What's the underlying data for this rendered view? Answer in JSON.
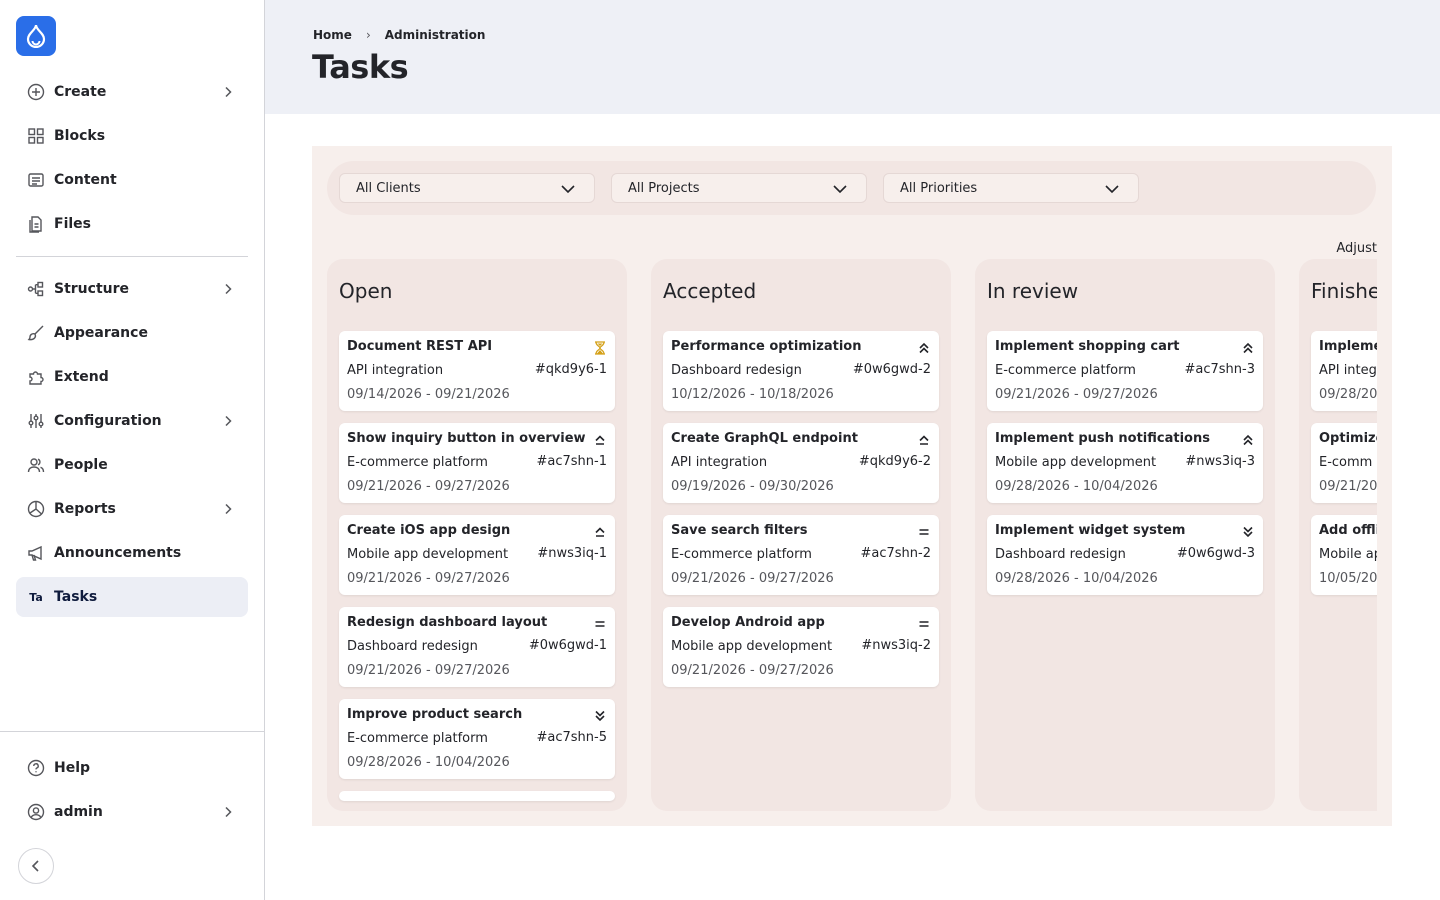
{
  "sidebar": {
    "items": [
      {
        "label": "Create",
        "icon": "plus-circle-icon",
        "has_submenu": true
      },
      {
        "label": "Blocks",
        "icon": "blocks-grid-icon",
        "has_submenu": false
      },
      {
        "label": "Content",
        "icon": "content-doc-icon",
        "has_submenu": false
      },
      {
        "label": "Files",
        "icon": "files-icon",
        "has_submenu": false
      },
      {
        "label": "Structure",
        "icon": "structure-icon",
        "has_submenu": true
      },
      {
        "label": "Appearance",
        "icon": "paintbrush-icon",
        "has_submenu": false
      },
      {
        "label": "Extend",
        "icon": "puzzle-icon",
        "has_submenu": false
      },
      {
        "label": "Configuration",
        "icon": "sliders-icon",
        "has_submenu": true
      },
      {
        "label": "People",
        "icon": "people-icon",
        "has_submenu": false
      },
      {
        "label": "Reports",
        "icon": "pie-chart-icon",
        "has_submenu": true
      },
      {
        "label": "Announcements",
        "icon": "megaphone-icon",
        "has_submenu": false
      },
      {
        "label": "Tasks",
        "icon": "tasks-badge",
        "badge": "Ta",
        "has_submenu": false,
        "active": true
      }
    ],
    "footer": [
      {
        "label": "Help",
        "icon": "help-icon"
      },
      {
        "label": "admin",
        "icon": "user-icon",
        "has_submenu": true
      }
    ]
  },
  "header": {
    "breadcrumb": [
      "Home",
      "Administration"
    ],
    "title": "Tasks"
  },
  "filters": {
    "clients": "All Clients",
    "projects": "All Projects",
    "priorities": "All Priorities"
  },
  "adjust_label": "Adjust",
  "colors": {
    "accent": "#2a6ee8",
    "board_bg": "#f7efec",
    "column_bg": "#f2e6e3",
    "header_bg": "#eef0f6",
    "pending_icon": "#d4a017"
  },
  "columns": [
    {
      "title": "Open",
      "cards": [
        {
          "title": "Document REST API",
          "project": "API integration",
          "id": "#qkd9y6-1",
          "dates": "09/14/2026 - 09/21/2026",
          "priority": "pending"
        },
        {
          "title": "Show inquiry button in overview",
          "project": "E-commerce platform",
          "id": "#ac7shn-1",
          "dates": "09/21/2026 - 09/27/2026",
          "priority": "high"
        },
        {
          "title": "Create iOS app design",
          "project": "Mobile app development",
          "id": "#nws3iq-1",
          "dates": "09/21/2026 - 09/27/2026",
          "priority": "high"
        },
        {
          "title": "Redesign dashboard layout",
          "project": "Dashboard redesign",
          "id": "#0w6gwd-1",
          "dates": "09/21/2026 - 09/27/2026",
          "priority": "medium"
        },
        {
          "title": "Improve product search",
          "project": "E-commerce platform",
          "id": "#ac7shn-5",
          "dates": "09/28/2026 - 10/04/2026",
          "priority": "low"
        }
      ]
    },
    {
      "title": "Accepted",
      "cards": [
        {
          "title": "Performance optimization",
          "project": "Dashboard redesign",
          "id": "#0w6gwd-2",
          "dates": "10/12/2026 - 10/18/2026",
          "priority": "highest"
        },
        {
          "title": "Create GraphQL endpoint",
          "project": "API integration",
          "id": "#qkd9y6-2",
          "dates": "09/19/2026 - 09/30/2026",
          "priority": "high"
        },
        {
          "title": "Save search filters",
          "project": "E-commerce platform",
          "id": "#ac7shn-2",
          "dates": "09/21/2026 - 09/27/2026",
          "priority": "medium"
        },
        {
          "title": "Develop Android app",
          "project": "Mobile app development",
          "id": "#nws3iq-2",
          "dates": "09/21/2026 - 09/27/2026",
          "priority": "medium"
        }
      ]
    },
    {
      "title": "In review",
      "cards": [
        {
          "title": "Implement shopping cart",
          "project": "E-commerce platform",
          "id": "#ac7shn-3",
          "dates": "09/21/2026 - 09/27/2026",
          "priority": "highest"
        },
        {
          "title": "Implement push notifications",
          "project": "Mobile app development",
          "id": "#nws3iq-3",
          "dates": "09/28/2026 - 10/04/2026",
          "priority": "highest"
        },
        {
          "title": "Implement widget system",
          "project": "Dashboard redesign",
          "id": "#0w6gwd-3",
          "dates": "09/28/2026 - 10/04/2026",
          "priority": "low"
        }
      ]
    },
    {
      "title": "Finishe",
      "cards": [
        {
          "title": "Impleme",
          "project": "API integ",
          "id": "",
          "dates": "09/28/20",
          "priority": ""
        },
        {
          "title": "Optimize",
          "project": "E-comm",
          "id": "",
          "dates": "09/21/202",
          "priority": ""
        },
        {
          "title": "Add offli",
          "project": "Mobile ap",
          "id": "",
          "dates": "10/05/202",
          "priority": ""
        }
      ]
    }
  ]
}
